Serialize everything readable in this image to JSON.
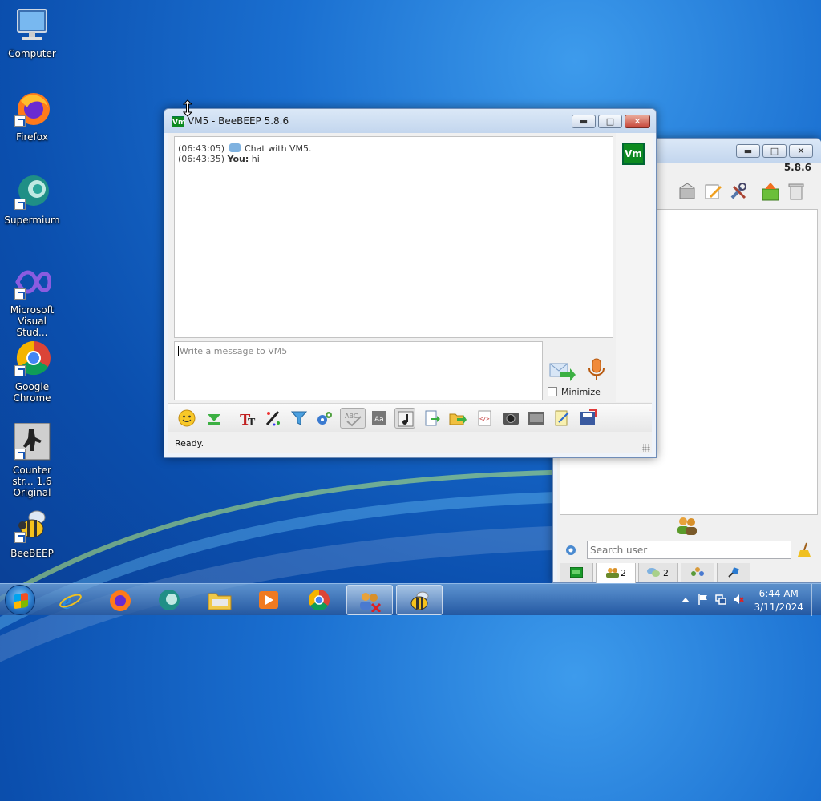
{
  "desktop": {
    "icons": [
      {
        "label": "Computer"
      },
      {
        "label": "Firefox"
      },
      {
        "label": "Supermium"
      },
      {
        "label": "Microsoft Visual Stud..."
      },
      {
        "label": "Google Chrome"
      },
      {
        "label": "Counter str... 1.6 Original"
      },
      {
        "label": "BeeBEEP"
      }
    ]
  },
  "chat_window": {
    "title": "VM5 - BeeBEEP 5.8.6",
    "title_icon": "Vm",
    "messages": [
      {
        "time": "(06:43:05)",
        "sender": "",
        "text": "Chat with VM5."
      },
      {
        "time": "(06:43:35)",
        "sender": "You:",
        "text": "hi"
      }
    ],
    "input_placeholder": "Write a message to VM5",
    "minimize_label": "Minimize",
    "avatar_label": "Vm",
    "status": "Ready.",
    "toolbar_icons": [
      "smiley-icon",
      "download-arrow-icon",
      "font-icon",
      "color-pen-icon",
      "filter-icon",
      "settings-gears-icon",
      "spellcheck-icon",
      "text-style-icon",
      "music-note-icon",
      "export-file-icon",
      "folder-send-icon",
      "html-icon",
      "screenshot-icon",
      "film-icon",
      "notes-icon",
      "save-icon"
    ]
  },
  "main_window": {
    "version": "5.8.6",
    "search_placeholder": "Search user",
    "tabs": [
      {
        "icon": "computer-icon",
        "count": ""
      },
      {
        "icon": "users-icon",
        "count": "2"
      },
      {
        "icon": "chat-bubbles-icon",
        "count": "2"
      },
      {
        "icon": "groups-icon",
        "count": ""
      },
      {
        "icon": "pin-icon",
        "count": ""
      }
    ]
  },
  "taskbar": {
    "apps": [
      "internet-explorer-icon",
      "firefox-icon",
      "supermium-icon",
      "file-explorer-icon",
      "media-player-icon",
      "chrome-icon",
      "network-users-icon",
      "beebeep-icon"
    ],
    "time": "6:44 AM",
    "date": "3/11/2024"
  }
}
